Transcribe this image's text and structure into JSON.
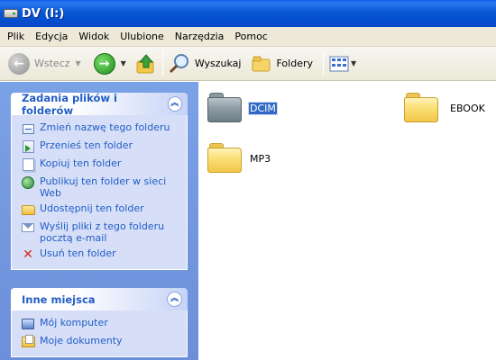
{
  "window": {
    "title": "DV (I:)"
  },
  "menubar": [
    "Plik",
    "Edycja",
    "Widok",
    "Ulubione",
    "Narzędzia",
    "Pomoc"
  ],
  "toolbar": {
    "back_label": "Wstecz",
    "search_label": "Wyszukaj",
    "folders_label": "Foldery"
  },
  "tasks_panel": {
    "title": "Zadania plików i folderów",
    "items": [
      {
        "label": "Zmień nazwę tego folderu",
        "icon": "rename-icon"
      },
      {
        "label": "Przenieś ten folder",
        "icon": "move-icon"
      },
      {
        "label": "Kopiuj ten folder",
        "icon": "copy-icon"
      },
      {
        "label": "Publikuj ten folder w sieci Web",
        "icon": "globe-icon"
      },
      {
        "label": "Udostępnij ten folder",
        "icon": "share-icon"
      },
      {
        "label": "Wyślij pliki z tego folderu pocztą e-mail",
        "icon": "mail-icon"
      },
      {
        "label": "Usuń ten folder",
        "icon": "delete-icon"
      }
    ]
  },
  "places_panel": {
    "title": "Inne miejsca",
    "items": [
      {
        "label": "Mój komputer",
        "icon": "computer-icon"
      },
      {
        "label": "Moje dokumenty",
        "icon": "documents-icon"
      }
    ]
  },
  "folders": [
    {
      "name": "DCIM",
      "selected": true,
      "color": "grey"
    },
    {
      "name": "EBOOK",
      "selected": false,
      "color": "yellow"
    },
    {
      "name": "MP3",
      "selected": false,
      "color": "yellow"
    }
  ]
}
